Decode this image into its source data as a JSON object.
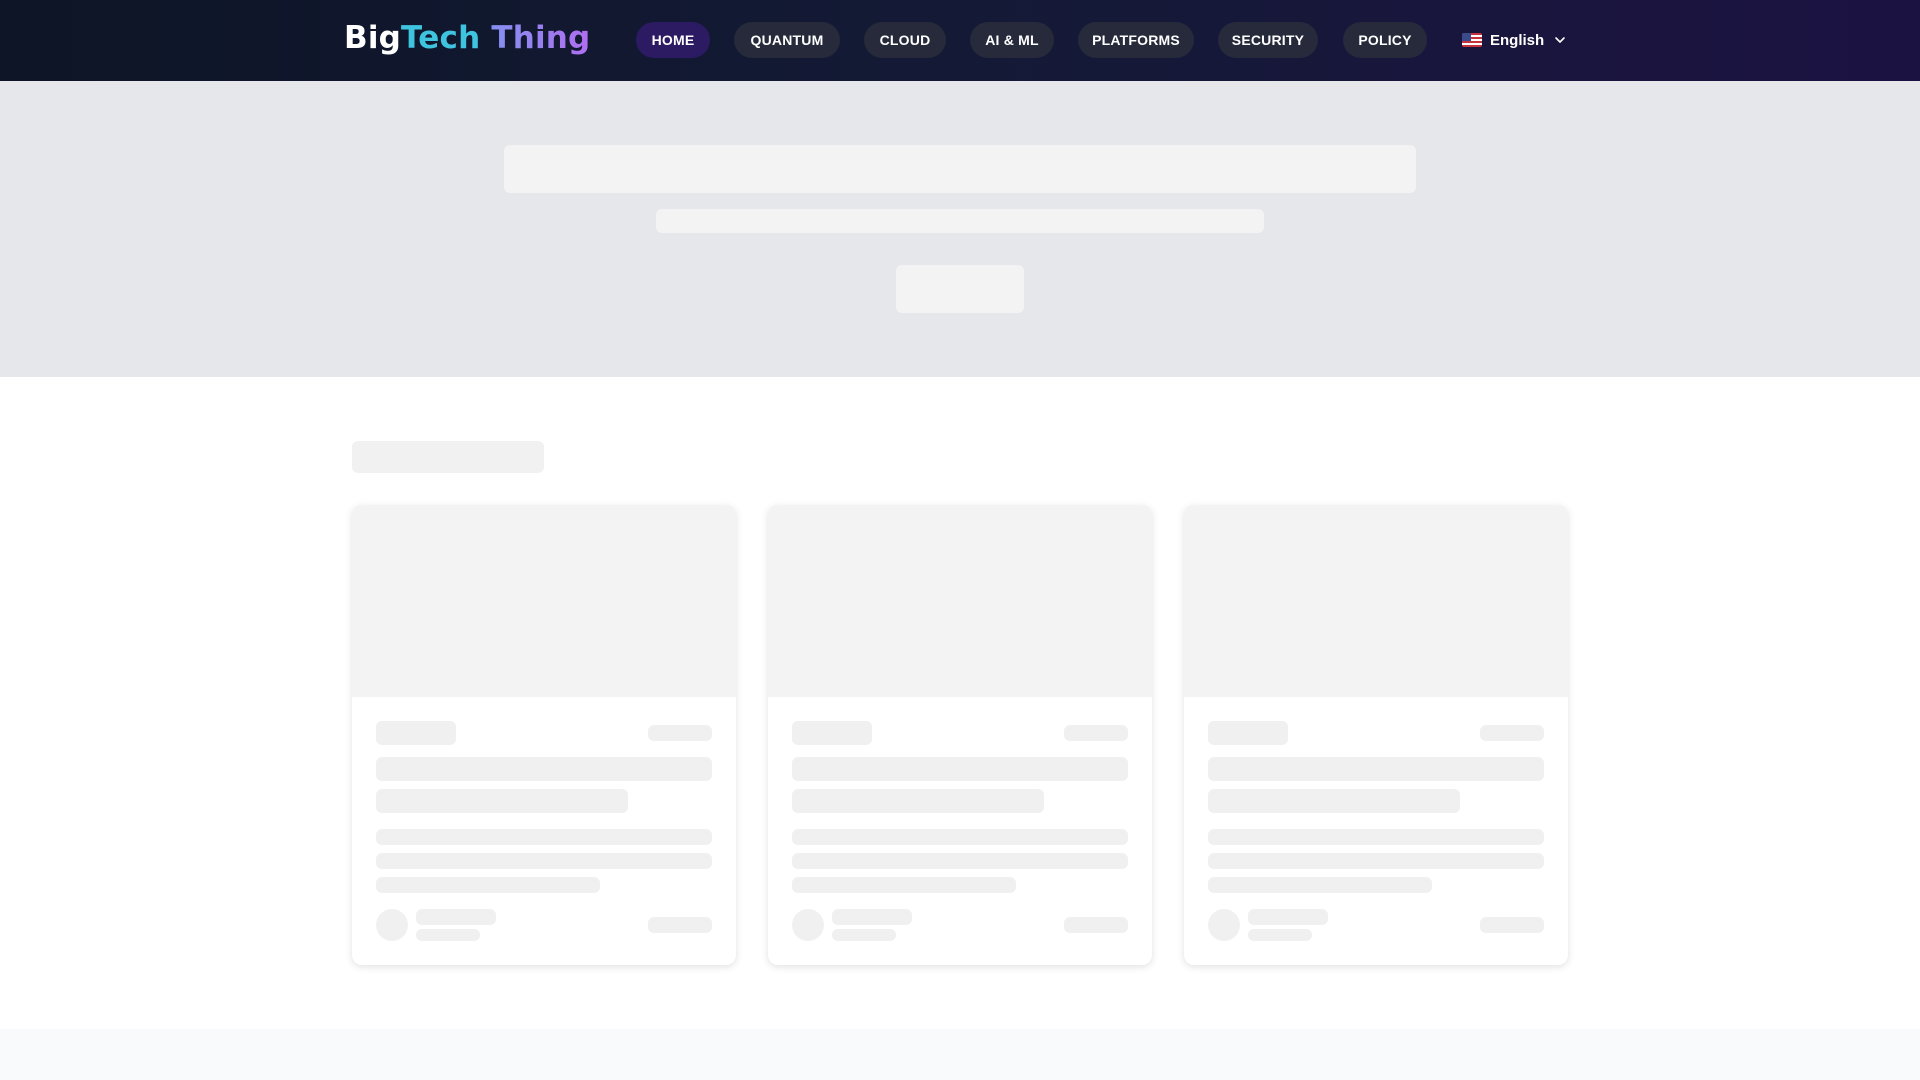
{
  "brand": {
    "part1": "Big",
    "part2": "Tech",
    "part3": " Thing"
  },
  "nav": {
    "items": [
      {
        "label": "HOME",
        "active": true
      },
      {
        "label": "QUANTUM",
        "active": false
      },
      {
        "label": "CLOUD",
        "active": false
      },
      {
        "label": "AI & ML",
        "active": false
      },
      {
        "label": "PLATFORMS",
        "active": false
      },
      {
        "label": "SECURITY",
        "active": false
      },
      {
        "label": "POLICY",
        "active": false
      }
    ],
    "language": {
      "label": "English",
      "flag_icon": "us-flag-icon",
      "chevron_icon": "chevron-down-icon"
    }
  },
  "colors": {
    "header_bg_start": "#0d1526",
    "header_bg_end": "#1c1242",
    "nav_pill": "#262a3b",
    "nav_pill_active": "#2c1a63",
    "brand_cyan": "#3fc4e0",
    "brand_purple": "#b06ef0",
    "hero_bg": "#e5e7eb",
    "skeleton": "#f3f3f3"
  },
  "state": "loading-skeleton"
}
